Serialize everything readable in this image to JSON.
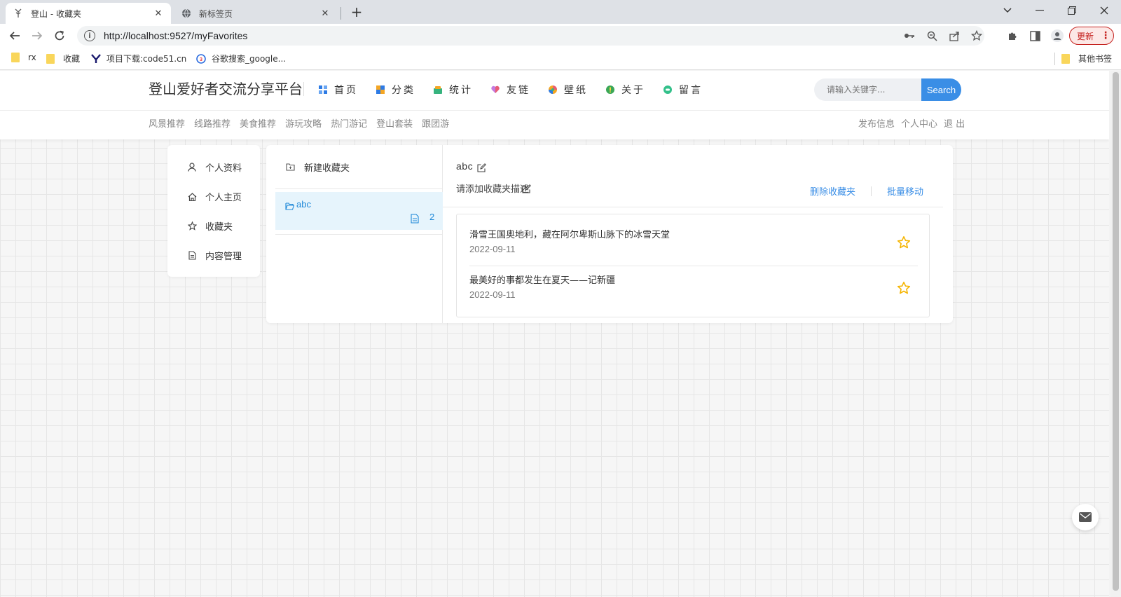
{
  "browser": {
    "tabs": [
      {
        "title": "登山 - 收藏夹",
        "active": true
      },
      {
        "title": "新标签页",
        "active": false
      }
    ],
    "url": "http://localhost:9527/myFavorites",
    "update_label": "更新",
    "bookmarks": [
      "rx",
      "收藏",
      "项目下载:code51.cn",
      "谷歌搜索_google..."
    ],
    "other_bookmarks": "其他书签"
  },
  "site": {
    "logo": "登山爱好者交流分享平台",
    "nav": [
      {
        "label": "首页",
        "icon": "grid-icon",
        "color": "#2d7be5"
      },
      {
        "label": "分类",
        "icon": "category-icon",
        "color": "#f5a623"
      },
      {
        "label": "统计",
        "icon": "chart-icon",
        "color": "#36b37e"
      },
      {
        "label": "友链",
        "icon": "heart-icon",
        "color": "#c47be0"
      },
      {
        "label": "壁纸",
        "icon": "palette-icon",
        "color": "#e85d75"
      },
      {
        "label": "关于",
        "icon": "info-icon",
        "color": "#3aa757"
      },
      {
        "label": "留言",
        "icon": "message-icon",
        "color": "#33c08a"
      }
    ],
    "search": {
      "placeholder": "请输入关键字...",
      "button": "Search"
    },
    "sub_nav": [
      "风景推荐",
      "线路推荐",
      "美食推荐",
      "游玩攻略",
      "热门游记",
      "登山套装",
      "跟团游"
    ],
    "user_nav": [
      "发布信息",
      "个人中心",
      "退 出"
    ]
  },
  "side_menu": [
    {
      "label": "个人资料",
      "icon": "user-icon"
    },
    {
      "label": "个人主页",
      "icon": "home-icon"
    },
    {
      "label": "收藏夹",
      "icon": "star-icon"
    },
    {
      "label": "内容管理",
      "icon": "document-icon"
    }
  ],
  "folders": {
    "new_folder_label": "新建收藏夹",
    "items": [
      {
        "name": "abc",
        "count": "2"
      }
    ]
  },
  "detail": {
    "title": "abc",
    "description": "请添加收藏夹描述",
    "delete_label": "删除收藏夹",
    "move_label": "批量移动",
    "articles": [
      {
        "title": "滑雪王国奥地利，藏在阿尔卑斯山脉下的冰雪天堂",
        "date": "2022-09-11"
      },
      {
        "title": "最美好的事都发生在夏天——记新疆",
        "date": "2022-09-11"
      }
    ]
  },
  "colors": {
    "accent": "#3a8ee6",
    "star": "#f5b400",
    "folder_active_bg": "#e6f4fc"
  }
}
